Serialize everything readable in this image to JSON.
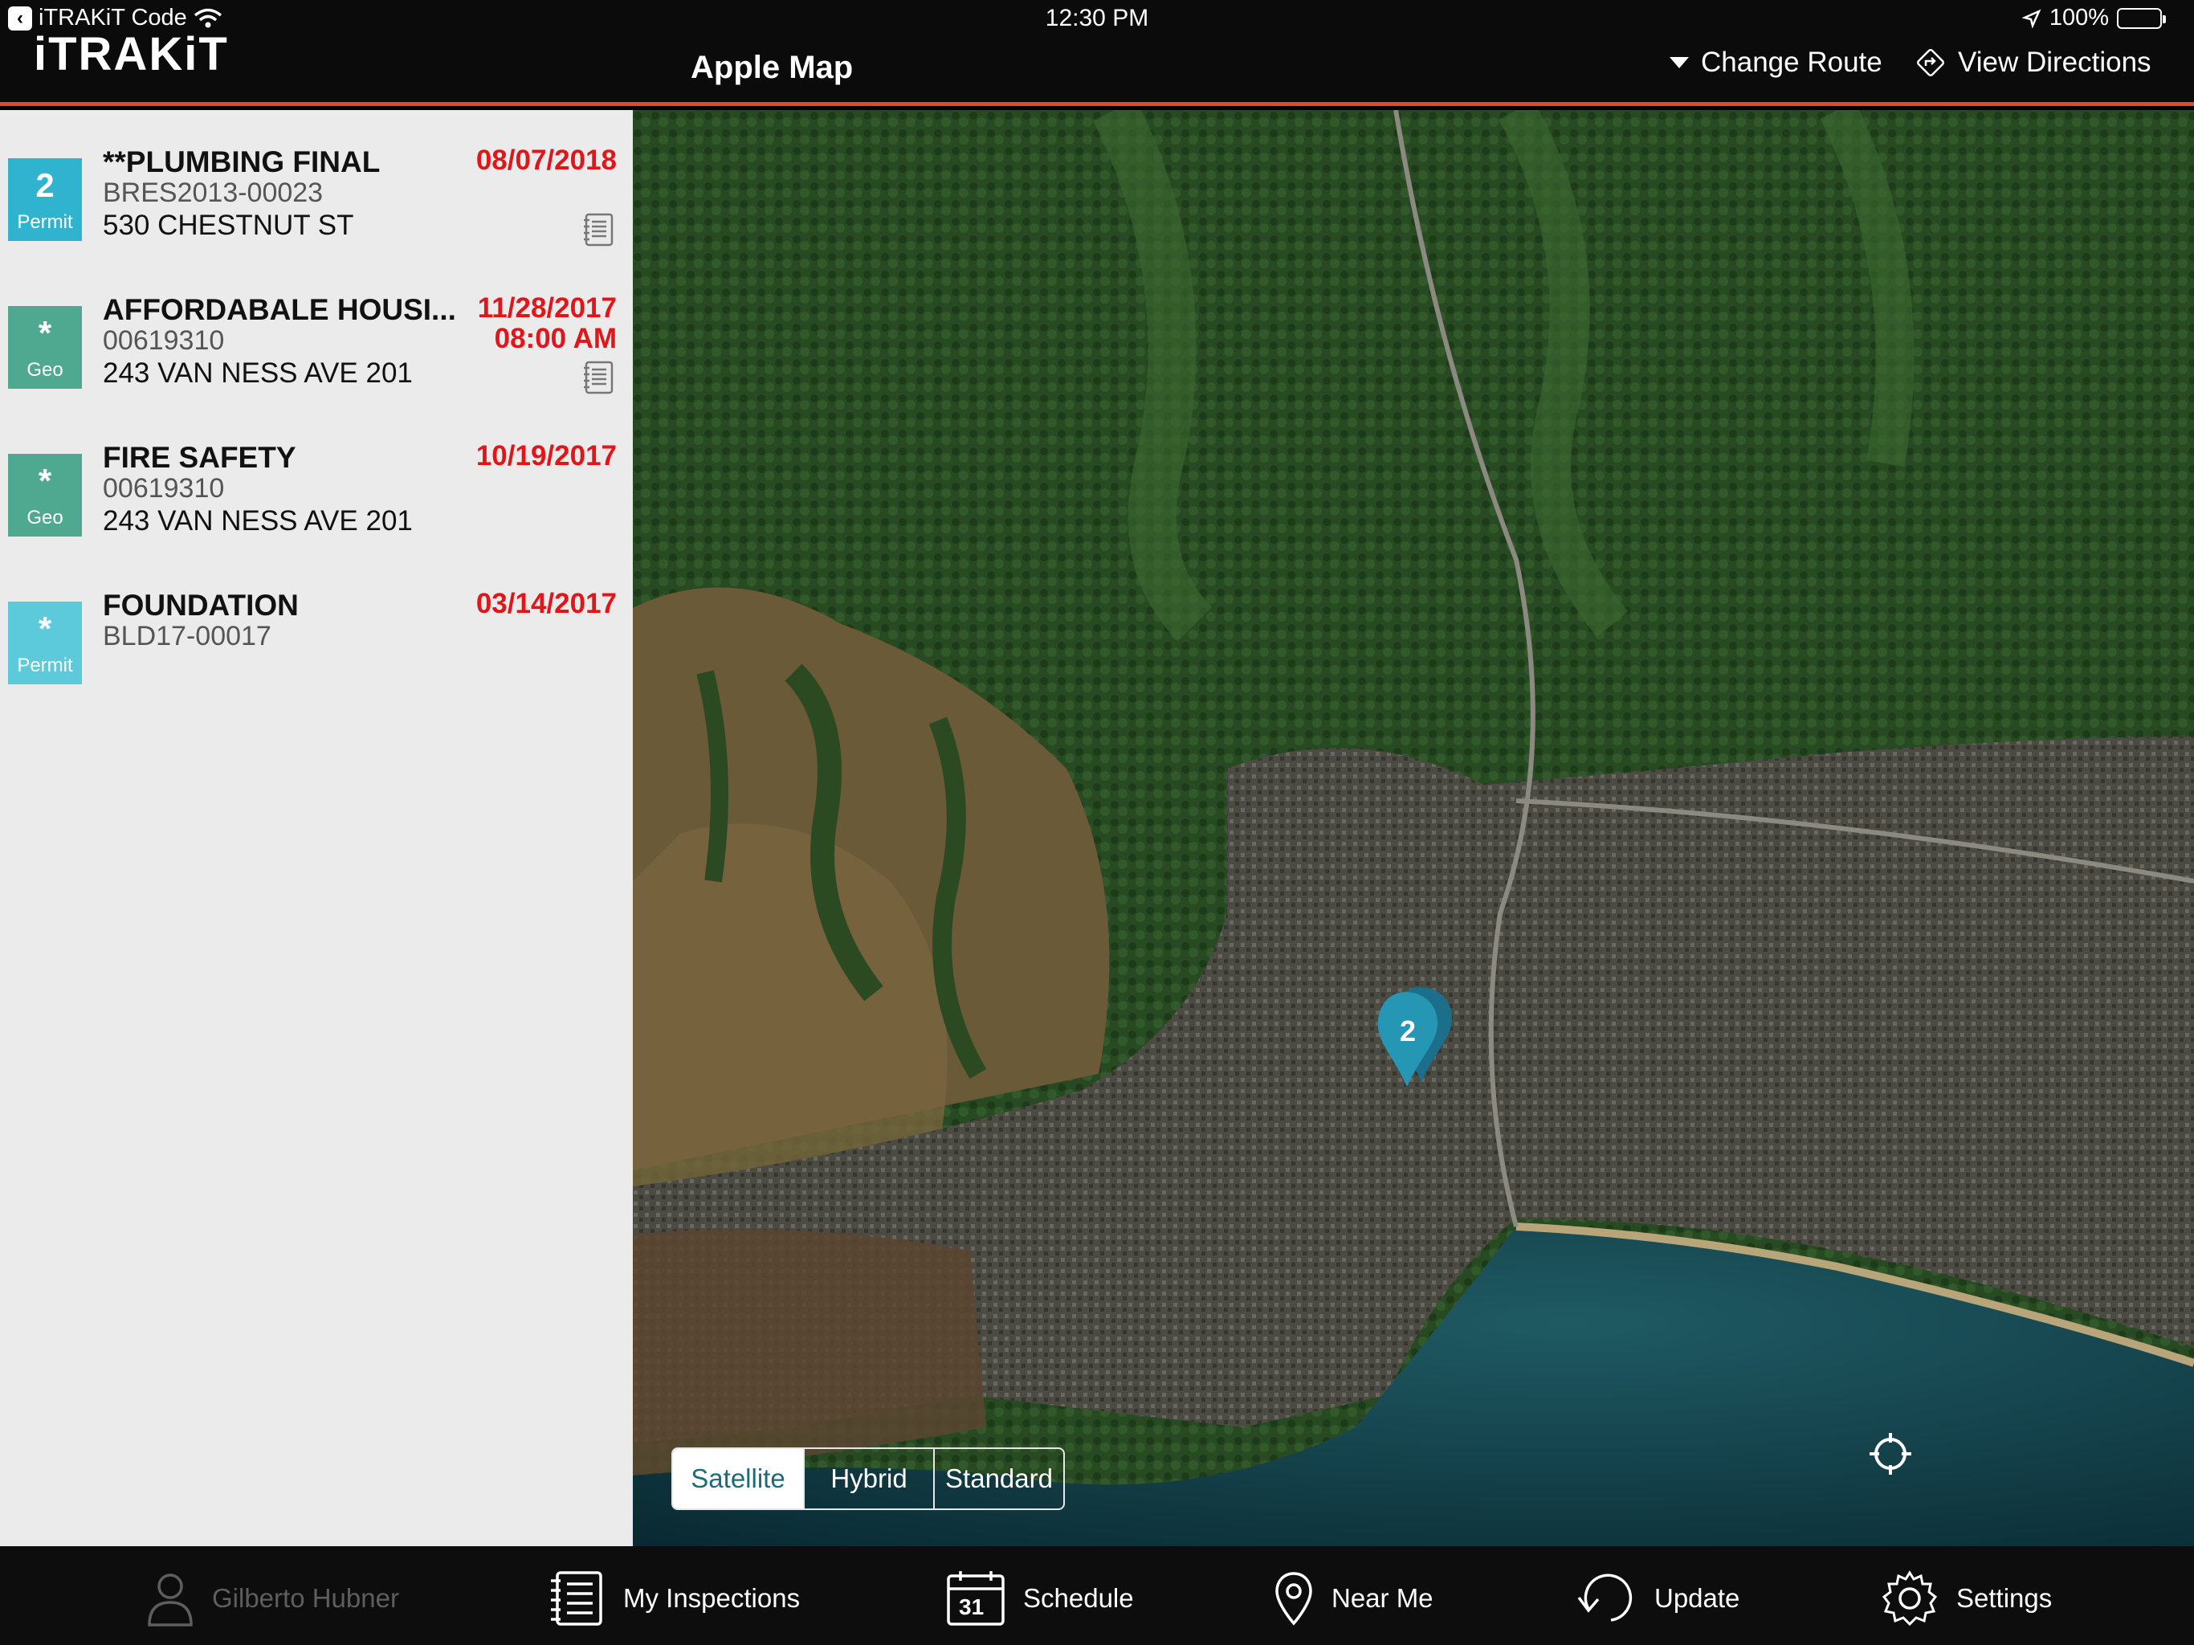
{
  "status_bar": {
    "back_app": "iTRAKiT Code",
    "time": "12:30 PM",
    "battery": "100%"
  },
  "header": {
    "logo": "iTRAKiT",
    "title": "Apple Map",
    "change_route": "Change Route",
    "view_directions": "View Directions",
    "accent_color": "#e8462b"
  },
  "inspections": [
    {
      "badge_value": "2",
      "badge_type": "Permit",
      "title": "**PLUMBING FINAL",
      "number": "BRES2013-00023",
      "address": "530 CHESTNUT ST",
      "date": "08/07/2018",
      "time": "",
      "has_notes": true
    },
    {
      "badge_value": "*",
      "badge_type": "Geo",
      "title": "AFFORDABALE HOUSI...",
      "number": "00619310",
      "address": "243 VAN NESS AVE 201",
      "date": "11/28/2017",
      "time": "08:00 AM",
      "has_notes": true
    },
    {
      "badge_value": "*",
      "badge_type": "Geo",
      "title": "FIRE SAFETY",
      "number": "00619310",
      "address": "243 VAN NESS AVE 201",
      "date": "10/19/2017",
      "time": "",
      "has_notes": false
    },
    {
      "badge_value": "*",
      "badge_type": "Permit",
      "title": "FOUNDATION",
      "number": "BLD17-00017",
      "address": "",
      "date": "03/14/2017",
      "time": "",
      "has_notes": false
    }
  ],
  "map": {
    "cluster_count": "2",
    "map_types": [
      "Satellite",
      "Hybrid",
      "Standard"
    ],
    "selected_map_type": "Satellite"
  },
  "tabbar": {
    "user": "Gilberto Hubner",
    "my_inspections": "My Inspections",
    "schedule": "Schedule",
    "schedule_day": "31",
    "near_me": "Near Me",
    "update": "Update",
    "settings": "Settings"
  }
}
